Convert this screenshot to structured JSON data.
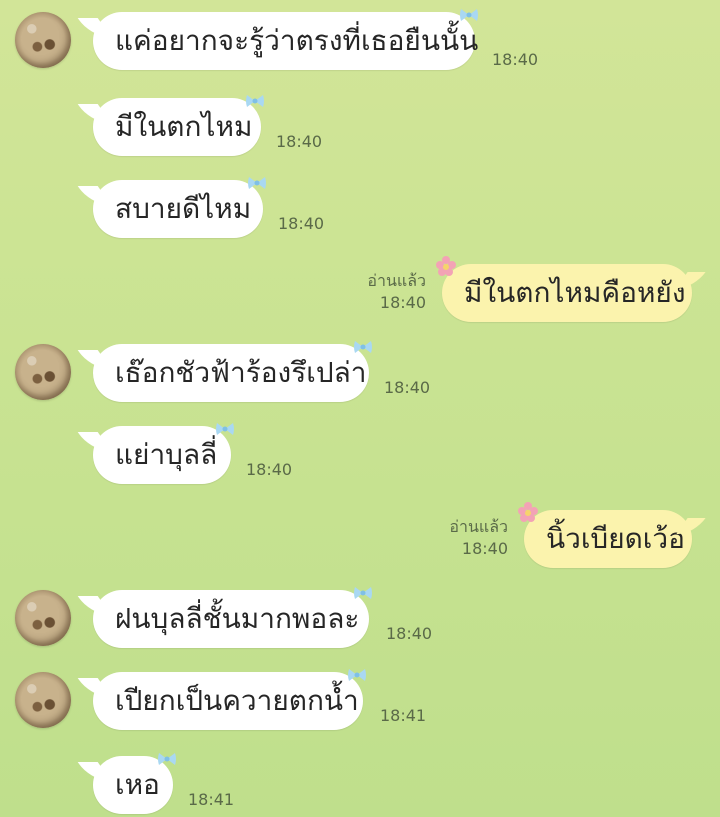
{
  "messages": [
    {
      "dir": "in",
      "text": "แค่อยากจะรู้ว่าตรงที่เธอยืนนั้น",
      "time": "18:40",
      "avatar": true
    },
    {
      "dir": "in",
      "text": "มีในตกไหม",
      "time": "18:40",
      "avatar": false
    },
    {
      "dir": "in",
      "text": "สบายดีไหม",
      "time": "18:40",
      "avatar": false
    },
    {
      "dir": "out",
      "text": "มีในตกไหมคือหยัง",
      "time": "18:40",
      "status": "อ่านแล้ว"
    },
    {
      "dir": "in",
      "text": "เธ๊อกชัวฟ้าร้องรึเปล่า",
      "time": "18:40",
      "avatar": true
    },
    {
      "dir": "in",
      "text": "แย่าบุลลี่",
      "time": "18:40",
      "avatar": false
    },
    {
      "dir": "out",
      "text": "นิ้วเบียดเว้อ",
      "time": "18:40",
      "status": "อ่านแล้ว"
    },
    {
      "dir": "in",
      "text": "ฝนบุลลี่ชั้นมากพอละ",
      "time": "18:40",
      "avatar": true
    },
    {
      "dir": "in",
      "text": "เปียกเป็นควายตกน้ำ",
      "time": "18:41",
      "avatar": true
    },
    {
      "dir": "in",
      "text": "เหอ",
      "time": "18:41",
      "avatar": false
    }
  ],
  "colors": {
    "incoming_bubble": "#ffffff",
    "outgoing_bubble": "#fbf3ad",
    "bow_deco": "#a9d8f2",
    "flower_deco": "#f3a3b5"
  },
  "icons": {
    "incoming_sticker": "blue-bow-icon",
    "outgoing_sticker": "pink-flower-icon",
    "avatar": "coconut-avatar"
  }
}
